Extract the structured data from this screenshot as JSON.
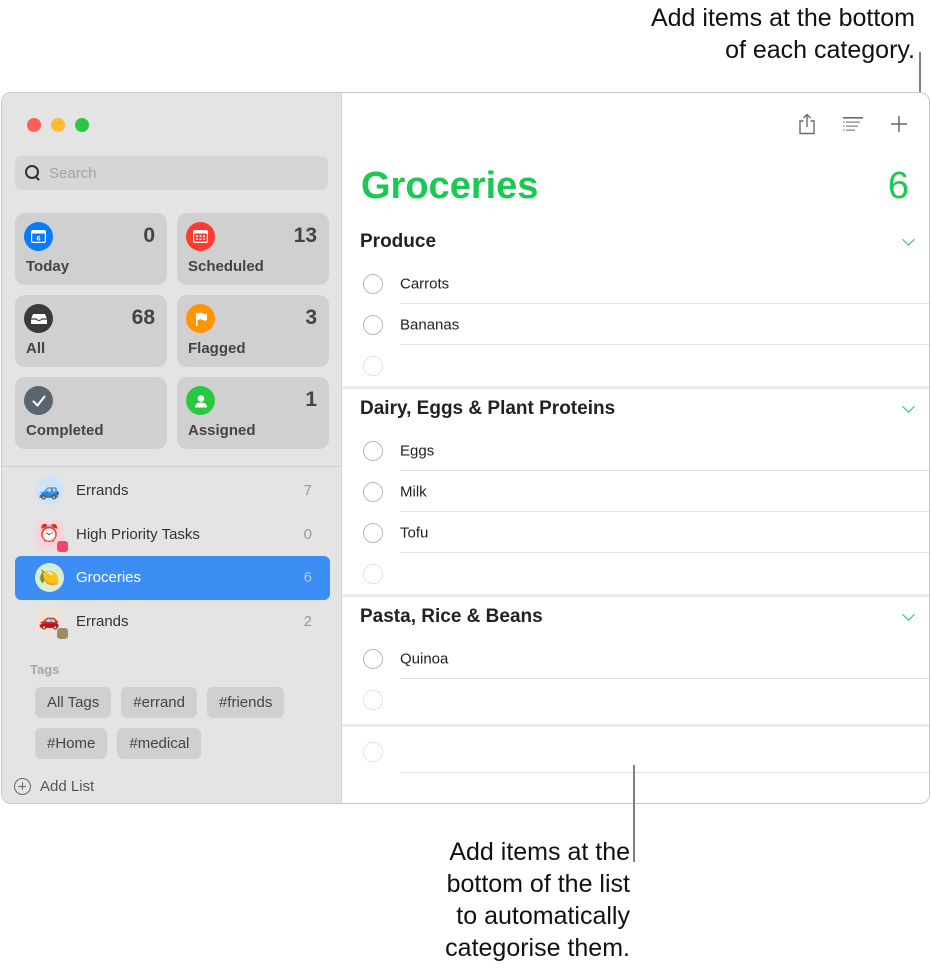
{
  "callouts": {
    "top": [
      "Add items at the bottom",
      "of each category."
    ],
    "bottom": [
      "Add items at the",
      "bottom of the list",
      "to automatically",
      "categorise them."
    ]
  },
  "window": {
    "traffic_lights": [
      "close",
      "minimize",
      "zoom"
    ]
  },
  "sidebar": {
    "search": {
      "placeholder": "Search",
      "value": ""
    },
    "smart_lists": [
      {
        "label": "Today",
        "count": "0",
        "icon": "calendar-today-icon",
        "color": "#0a7aff"
      },
      {
        "label": "Scheduled",
        "count": "13",
        "icon": "calendar-grid-icon",
        "color": "#fe3b30"
      },
      {
        "label": "All",
        "count": "68",
        "icon": "tray-icon",
        "color": "#3a3a3c"
      },
      {
        "label": "Flagged",
        "count": "3",
        "icon": "flag-icon",
        "color": "#ff9500"
      },
      {
        "label": "Completed",
        "count": "",
        "icon": "checkmark-icon",
        "color": "#5b6570"
      },
      {
        "label": "Assigned",
        "count": "1",
        "icon": "person-icon",
        "color": "#28c840"
      }
    ],
    "lists": [
      {
        "name": "Errands",
        "count": "7",
        "icon": "blue-car-icon",
        "emoji": "🚙",
        "bg": "#cfe2fb",
        "selected": false
      },
      {
        "name": "High Priority Tasks",
        "count": "0",
        "icon": "alarm-clock-icon",
        "emoji": "⏰",
        "bg": "#fbd4da",
        "selected": false
      },
      {
        "name": "Groceries",
        "count": "6",
        "icon": "lemon-icon",
        "emoji": "🍋",
        "bg": "#d7efd1",
        "selected": true
      },
      {
        "name": "Errands",
        "count": "2",
        "icon": "red-car-icon",
        "emoji": "🚗",
        "bg": "#ece3d9",
        "selected": false
      }
    ],
    "tags_label": "Tags",
    "tags": [
      "All Tags",
      "#errand",
      "#friends",
      "#Home",
      "#medical"
    ],
    "add_list_label": "Add List"
  },
  "main": {
    "toolbar": [
      "share-icon",
      "list-options-icon",
      "add-icon"
    ],
    "title": "Groceries",
    "count": "6",
    "accent": "#1bc853",
    "sections": [
      {
        "name": "Produce",
        "items": [
          "Carrots",
          "Bananas"
        ]
      },
      {
        "name": "Dairy, Eggs & Plant Proteins",
        "items": [
          "Eggs",
          "Milk",
          "Tofu"
        ]
      },
      {
        "name": "Pasta, Rice & Beans",
        "items": [
          "Quinoa"
        ]
      }
    ]
  }
}
